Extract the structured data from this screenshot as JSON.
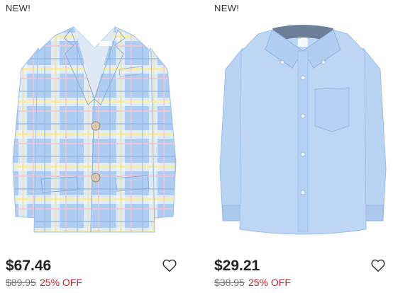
{
  "products": [
    {
      "badge": "NEW!",
      "image_icon": "plaid-blazer-image",
      "price": "$67.46",
      "original_price": "$89.95",
      "discount": "25% OFF"
    },
    {
      "badge": "NEW!",
      "image_icon": "oxford-shirt-image",
      "price": "$29.21",
      "original_price": "$38.95",
      "discount": "25% OFF"
    }
  ],
  "colors": {
    "discount": "#c8202d",
    "plaid_base": "#aecdf0",
    "shirt_base": "#b7d3f2"
  }
}
